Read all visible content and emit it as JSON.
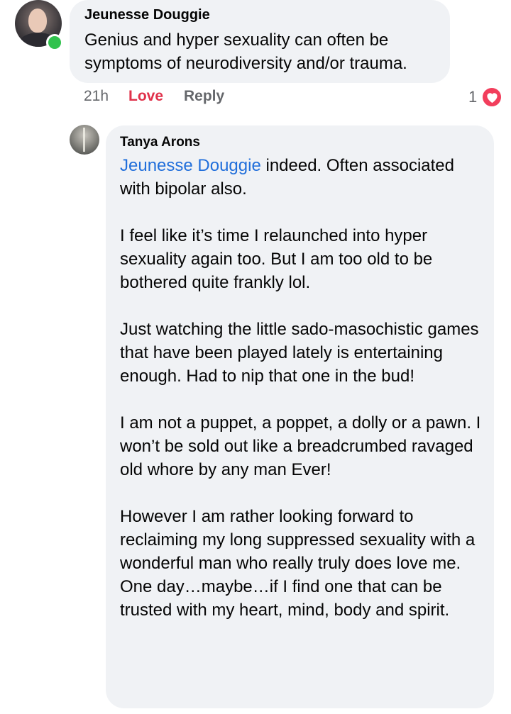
{
  "comment_1": {
    "author": "Jeunesse Douggie",
    "text": "Genius and hyper sexuality can often be symptoms of neurodiversity and/or trauma.",
    "online": true,
    "timestamp": "21h",
    "reaction_action": "Love",
    "reply_label": "Reply",
    "reaction_count": "1",
    "reaction_icon": "heart-icon",
    "reaction_color": "#f23e5c"
  },
  "comment_2": {
    "author": "Tanya Arons",
    "mention": "Jeunesse Douggie",
    "paragraphs": [
      "indeed. Often associated with bipolar also.",
      "I feel like it’s time I relaunched into hyper sexuality again too.  But I am too old to be bothered quite frankly lol.",
      "Just watching the little sado-masochistic games that have been played lately is entertaining enough.  Had to nip that one in the bud!",
      "I am not a puppet, a poppet, a dolly or a pawn.  I won’t be sold out like a breadcrumbed ravaged old whore by any man Ever!",
      "However I am rather looking forward to reclaiming my long suppressed sexuality with a wonderful man who really truly does love me.  One day…maybe…if I find one that can be trusted with my heart, mind, body and spirit."
    ]
  },
  "colors": {
    "bubble_bg": "#f0f2f5",
    "mention": "#216fdb",
    "love_action": "#e0314a",
    "online_dot": "#31c24d",
    "secondary_text": "#65676b"
  }
}
